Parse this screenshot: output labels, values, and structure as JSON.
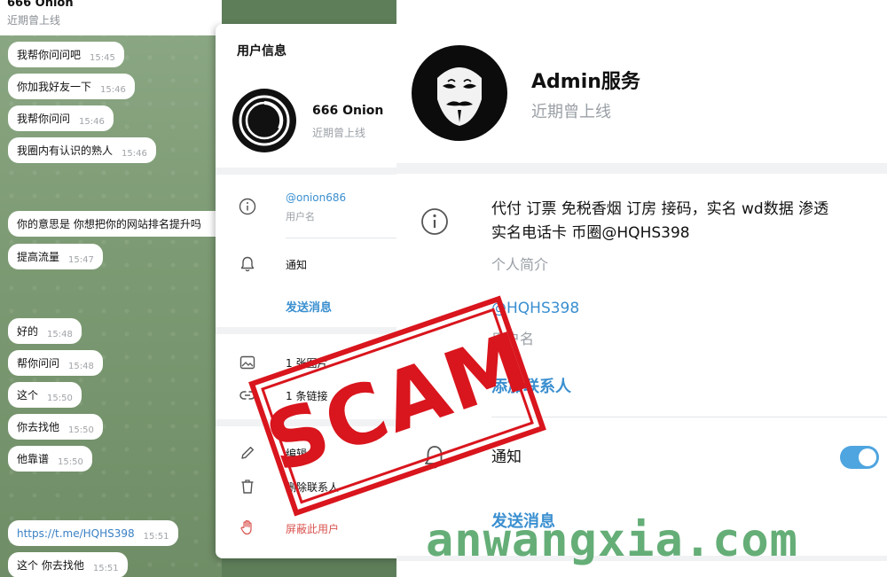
{
  "chat": {
    "title": "666 Onion",
    "status": "近期曾上线",
    "messages": [
      {
        "text": "我帮你问问吧",
        "time": "15:45"
      },
      {
        "text": "你加我好友一下",
        "time": "15:46"
      },
      {
        "text": "我帮你问问",
        "time": "15:46"
      },
      {
        "text": "我圈内有认识的熟人",
        "time": "15:46"
      },
      {
        "text": "你的意思是 你想把你的网站排名提升吗",
        "time": ""
      },
      {
        "text": "提高流量",
        "time": "15:47"
      },
      {
        "text": "好的",
        "time": "15:48"
      },
      {
        "text": "帮你问问",
        "time": "15:48"
      },
      {
        "text": "这个",
        "time": "15:50"
      },
      {
        "text": "你去找他",
        "time": "15:50"
      },
      {
        "text": "他靠谱",
        "time": "15:50"
      },
      {
        "text": "https://t.me/HQHS398",
        "time": "15:51"
      },
      {
        "text": "这个 你去找他",
        "time": "15:51"
      }
    ]
  },
  "info_card": {
    "title": "用户信息",
    "name": "666 Onion",
    "status": "近期曾上线",
    "username": "@onion686",
    "username_label": "用户名",
    "notify_label": "通知",
    "send_message": "发送消息",
    "photos": "1 张图片",
    "links": "1 条链接",
    "edit": "编辑",
    "delete_contact": "删除联系人",
    "block_user": "屏蔽此用户"
  },
  "profile": {
    "name": "Admin服务",
    "status": "近期曾上线",
    "bio_line1": "代付 订票 免税香烟 订房 接码，实名 wd数据 渗透",
    "bio_line2": "实名电话卡 币圈@HQHS398",
    "bio_label": "个人简介",
    "username": "@HQHS398",
    "username_label": "用户名",
    "add_contact": "添加联系人",
    "notify_label": "通知",
    "notify_on": true,
    "send_message": "发送消息"
  },
  "stamp": {
    "text": "SCAM",
    "color": "#d9151d"
  },
  "watermark": {
    "text": "anwangxia.com",
    "color": "#58a86c"
  },
  "icons": {
    "info": "info-icon",
    "bell": "bell-icon",
    "image": "image-icon",
    "link": "link-icon",
    "pencil": "pencil-icon",
    "trash": "trash-icon",
    "hand": "hand-stop-icon"
  },
  "colors": {
    "accent": "#3a8fd0",
    "danger": "#d9534f",
    "toggle": "#4ea5df"
  }
}
